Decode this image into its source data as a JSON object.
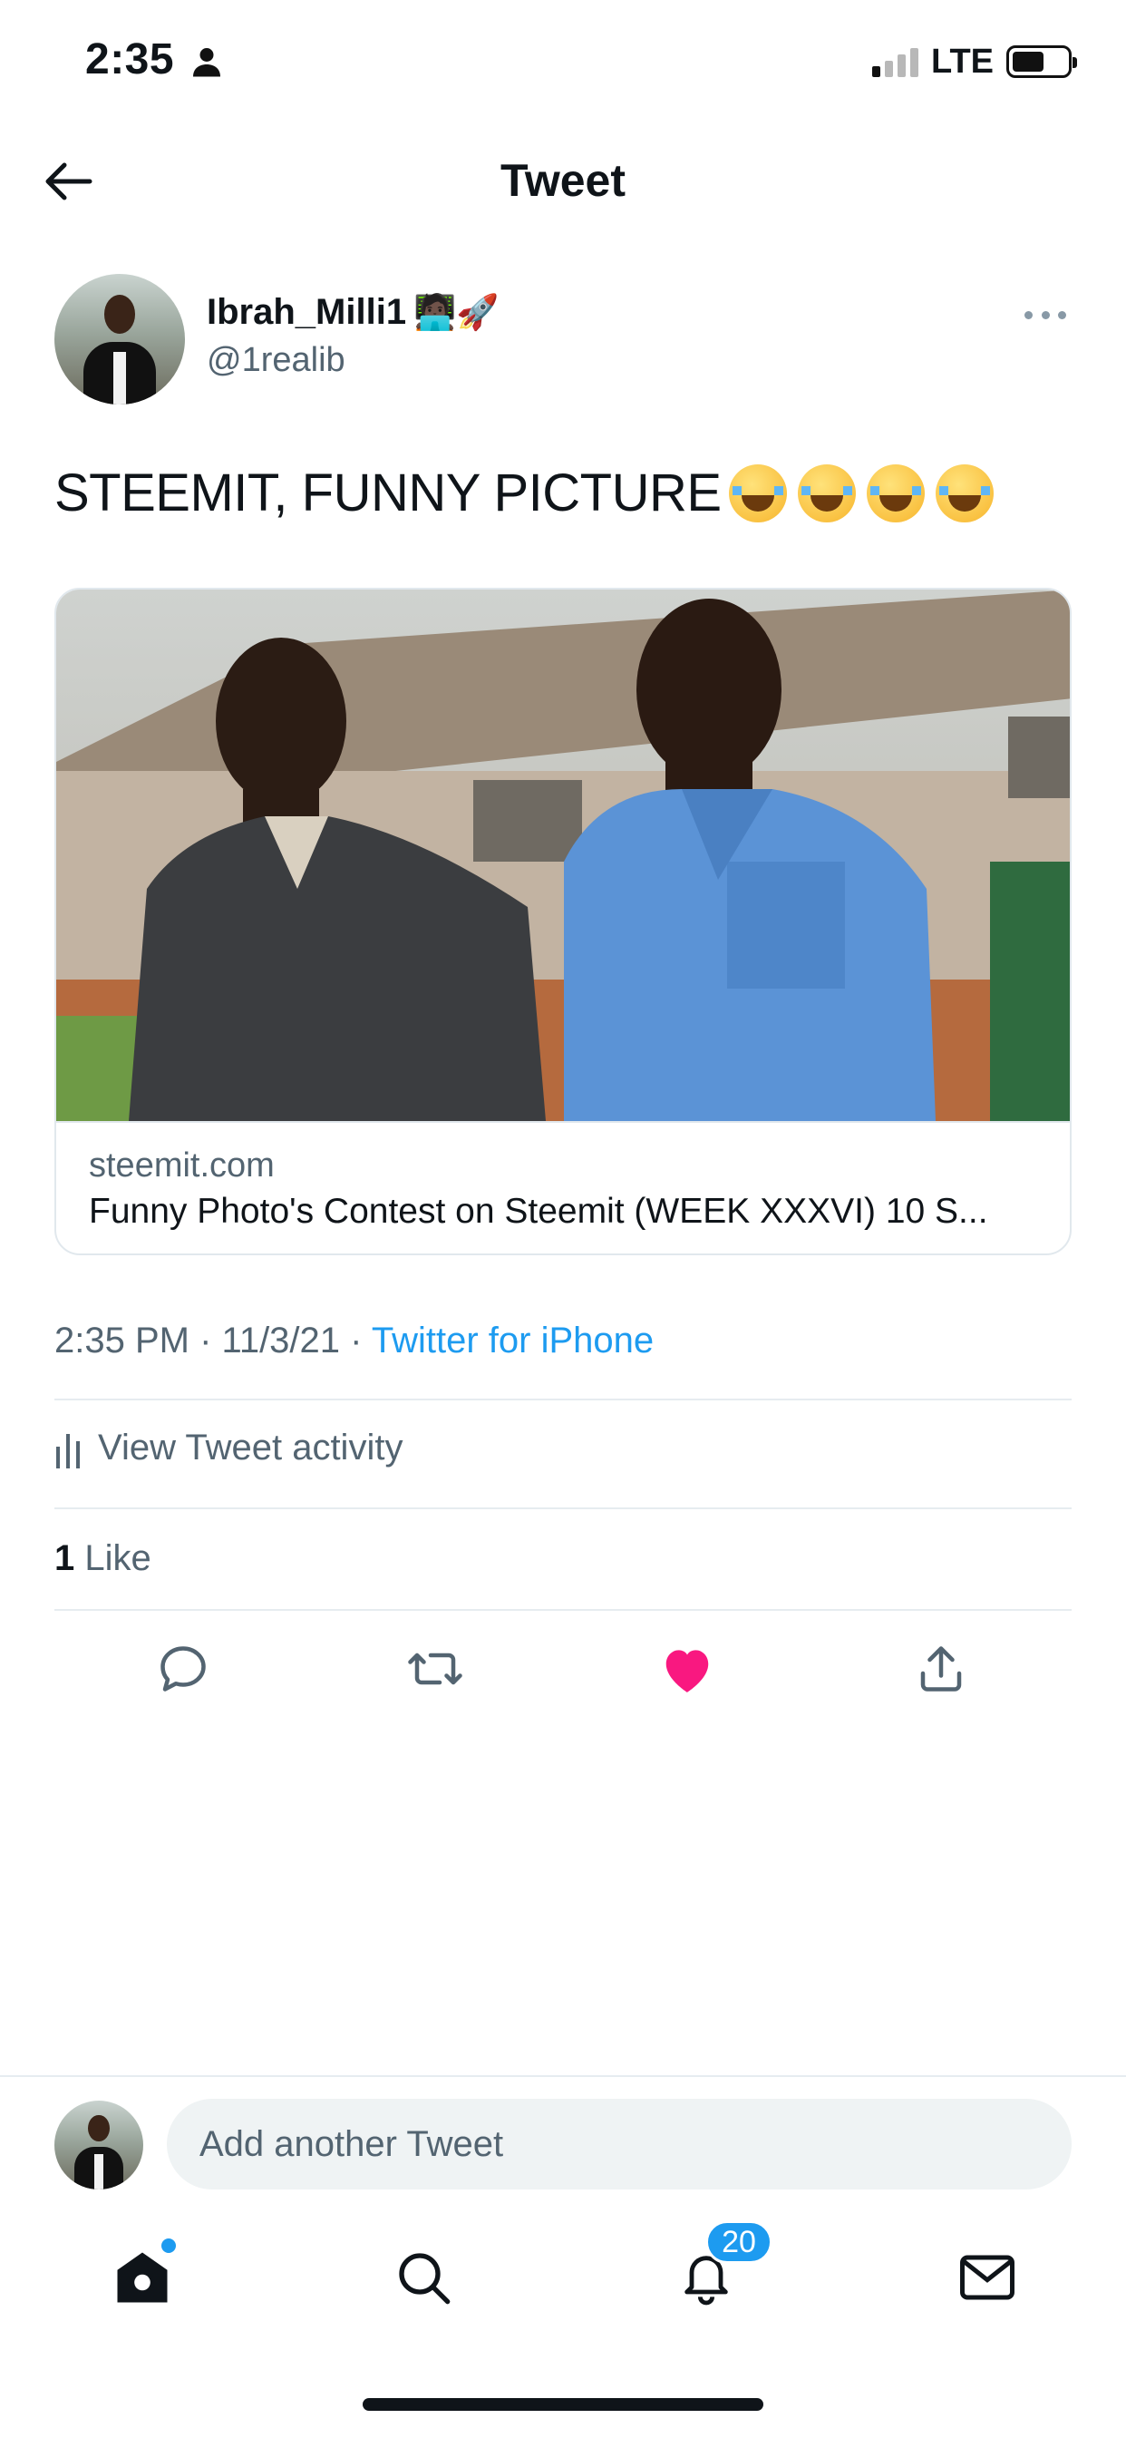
{
  "status_bar": {
    "time": "2:35",
    "network": "LTE",
    "person_icon": "person-icon",
    "signal_icon": "signal-bars-icon",
    "battery_icon": "battery-icon"
  },
  "header": {
    "title": "Tweet",
    "back_icon": "arrow-left-icon"
  },
  "author": {
    "display_name": "Ibrah_Milli1",
    "name_emoji": "🧑🏿‍💻🚀",
    "handle": "@1realib",
    "more_icon": "ellipsis-icon"
  },
  "tweet": {
    "text": "STEEMIT, FUNNY PICTURE",
    "emoji_icon": "face-with-tears-of-joy-icon",
    "emoji_count": 4
  },
  "card": {
    "domain": "steemit.com",
    "title": "Funny Photo's Contest on Steemit (WEEK XXXVI) 10 S..."
  },
  "meta": {
    "time": "2:35 PM",
    "separator": "·",
    "date": "11/3/21",
    "source": "Twitter for iPhone"
  },
  "activity": {
    "label": "View Tweet activity",
    "icon": "bar-chart-icon"
  },
  "likes": {
    "count": "1",
    "label": "Like"
  },
  "actions": {
    "reply_icon": "reply-icon",
    "retweet_icon": "retweet-icon",
    "like_icon": "heart-icon",
    "share_icon": "share-icon",
    "like_color": "#f91880"
  },
  "reply_bar": {
    "placeholder": "Add another Tweet"
  },
  "tab_bar": {
    "home_icon": "home-icon",
    "search_icon": "search-icon",
    "notifications_icon": "bell-icon",
    "notifications_badge": "20",
    "messages_icon": "mail-icon"
  },
  "colors": {
    "accent": "#1d9bf0",
    "text_primary": "#0f1419",
    "text_secondary": "#536471",
    "divider": "#e6ecf0"
  }
}
